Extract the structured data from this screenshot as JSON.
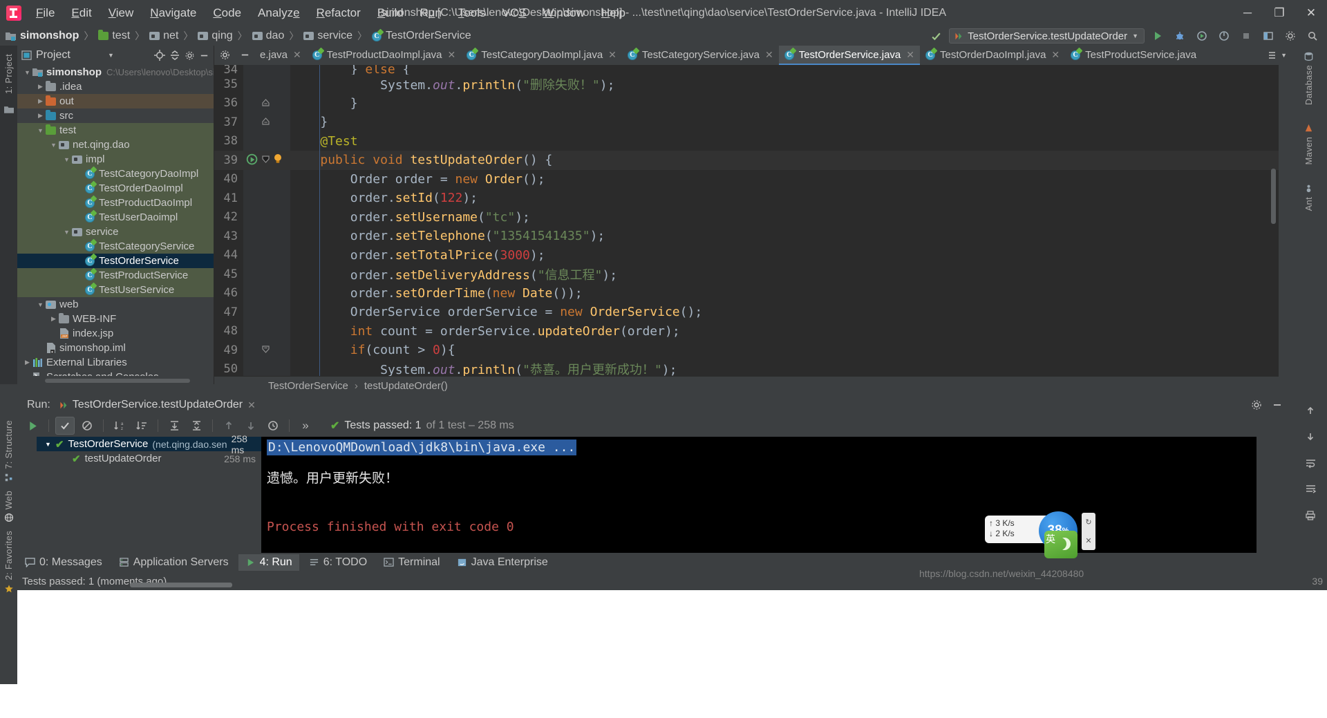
{
  "titlebar": {
    "app_icon": "intellij-logo-icon",
    "window_title": "simonshop [C:\\Users\\lenovo\\Desktop\\simonshop] - ...\\test\\net\\qing\\dao\\service\\TestOrderService.java - IntelliJ IDEA",
    "menus": [
      {
        "label": "File"
      },
      {
        "label": "Edit"
      },
      {
        "label": "View"
      },
      {
        "label": "Navigate"
      },
      {
        "label": "Code"
      },
      {
        "label": "Analyze"
      },
      {
        "label": "Refactor"
      },
      {
        "label": "Build"
      },
      {
        "label": "Run"
      },
      {
        "label": "Tools"
      },
      {
        "label": "VCS"
      },
      {
        "label": "Window"
      },
      {
        "label": "Help"
      }
    ],
    "minimize": "─",
    "maximize": "❐",
    "close": "✕"
  },
  "breadcrumb": {
    "items": [
      {
        "label": "simonshop",
        "icon": "module-folder-icon"
      },
      {
        "label": "test",
        "icon": "test-folder-icon"
      },
      {
        "label": "net",
        "icon": "package-icon"
      },
      {
        "label": "qing",
        "icon": "package-icon"
      },
      {
        "label": "dao",
        "icon": "package-icon"
      },
      {
        "label": "service",
        "icon": "package-icon"
      },
      {
        "label": "TestOrderService",
        "icon": "java-class-icon"
      }
    ],
    "separator": "〉"
  },
  "run_config": {
    "name": "TestOrderService.testUpdateOrder",
    "dropdown_icon": "chevron-down-icon",
    "buttons": [
      "run-icon",
      "debug-icon",
      "run-with-coverage-icon",
      "profile-icon",
      "stop-icon",
      "layout-icon",
      "settings-icon",
      "search-icon"
    ]
  },
  "project_panel": {
    "title": "Project",
    "dropdown_icon": "chevron-down-icon",
    "target_icon": "scroll-from-source-icon",
    "collapse_icon": "collapse-all-icon",
    "settings_icon": "gear-icon",
    "hide_icon": "hide-icon",
    "strip_label": "1: Project",
    "tree": [
      {
        "label": "simonshop",
        "path": "C:\\Users\\lenovo\\Desktop\\sim",
        "depth": 0,
        "arrow": "▼",
        "icon": "module-icon",
        "bold": true,
        "scope": ""
      },
      {
        "label": ".idea",
        "path": "",
        "depth": 1,
        "arrow": "▶",
        "icon": "folder-gray-icon",
        "bold": false,
        "scope": ""
      },
      {
        "label": "out",
        "path": "",
        "depth": 1,
        "arrow": "▶",
        "icon": "folder-orange-icon",
        "bold": false,
        "scope": "out"
      },
      {
        "label": "src",
        "path": "",
        "depth": 1,
        "arrow": "▶",
        "icon": "folder-blue-icon",
        "bold": false,
        "scope": ""
      },
      {
        "label": "test",
        "path": "",
        "depth": 1,
        "arrow": "▼",
        "icon": "folder-green-icon",
        "bold": false,
        "scope": "test"
      },
      {
        "label": "net.qing.dao",
        "path": "",
        "depth": 2,
        "arrow": "▼",
        "icon": "package-icon",
        "bold": false,
        "scope": "test"
      },
      {
        "label": "impl",
        "path": "",
        "depth": 3,
        "arrow": "▼",
        "icon": "package-icon",
        "bold": false,
        "scope": "test"
      },
      {
        "label": "TestCategoryDaoImpl",
        "path": "",
        "depth": 4,
        "arrow": "",
        "icon": "java-test-class-icon",
        "bold": false,
        "scope": "test"
      },
      {
        "label": "TestOrderDaoImpl",
        "path": "",
        "depth": 4,
        "arrow": "",
        "icon": "java-test-class-icon",
        "bold": false,
        "scope": "test"
      },
      {
        "label": "TestProductDaoImpl",
        "path": "",
        "depth": 4,
        "arrow": "",
        "icon": "java-test-class-icon",
        "bold": false,
        "scope": "test"
      },
      {
        "label": "TestUserDaoimpl",
        "path": "",
        "depth": 4,
        "arrow": "",
        "icon": "java-test-class-icon",
        "bold": false,
        "scope": "test"
      },
      {
        "label": "service",
        "path": "",
        "depth": 3,
        "arrow": "▼",
        "icon": "package-icon",
        "bold": false,
        "scope": "test"
      },
      {
        "label": "TestCategoryService",
        "path": "",
        "depth": 4,
        "arrow": "",
        "icon": "java-test-class-icon",
        "bold": false,
        "scope": "test"
      },
      {
        "label": "TestOrderService",
        "path": "",
        "depth": 4,
        "arrow": "",
        "icon": "java-test-class-icon",
        "bold": false,
        "scope": "selected"
      },
      {
        "label": "TestProductService",
        "path": "",
        "depth": 4,
        "arrow": "",
        "icon": "java-test-class-icon",
        "bold": false,
        "scope": "test"
      },
      {
        "label": "TestUserService",
        "path": "",
        "depth": 4,
        "arrow": "",
        "icon": "java-test-class-icon",
        "bold": false,
        "scope": "test"
      },
      {
        "label": "web",
        "path": "",
        "depth": 1,
        "arrow": "▼",
        "icon": "web-folder-icon",
        "bold": false,
        "scope": ""
      },
      {
        "label": "WEB-INF",
        "path": "",
        "depth": 2,
        "arrow": "▶",
        "icon": "folder-gray-icon",
        "bold": false,
        "scope": ""
      },
      {
        "label": "index.jsp",
        "path": "",
        "depth": 2,
        "arrow": "",
        "icon": "jsp-file-icon",
        "bold": false,
        "scope": ""
      },
      {
        "label": "simonshop.iml",
        "path": "",
        "depth": 1,
        "arrow": "",
        "icon": "iml-file-icon",
        "bold": false,
        "scope": ""
      },
      {
        "label": "External Libraries",
        "path": "",
        "depth": 0,
        "arrow": "▶",
        "icon": "libraries-icon",
        "bold": false,
        "scope": ""
      },
      {
        "label": "Scratches and Consoles",
        "path": "",
        "depth": 0,
        "arrow": "",
        "icon": "scratches-icon",
        "bold": false,
        "scope": ""
      }
    ]
  },
  "editor_tabs": [
    {
      "label": "e.java",
      "icon": "java-class-icon",
      "active": false,
      "close": "✕"
    },
    {
      "label": "TestProductDaoImpl.java",
      "icon": "java-class-icon",
      "active": false,
      "close": "✕"
    },
    {
      "label": "TestCategoryDaoImpl.java",
      "icon": "java-class-icon",
      "active": false,
      "close": "✕"
    },
    {
      "label": "TestCategoryService.java",
      "icon": "java-class-icon",
      "active": false,
      "close": "✕"
    },
    {
      "label": "TestOrderService.java",
      "icon": "java-class-icon",
      "active": true,
      "close": "✕"
    },
    {
      "label": "TestOrderDaoImpl.java",
      "icon": "java-class-icon",
      "active": false,
      "close": "✕"
    },
    {
      "label": "TestProductService.java",
      "icon": "java-class-icon",
      "active": false,
      "close": ""
    }
  ],
  "editor": {
    "first_partial_line": "34",
    "lines": [
      {
        "no": "35",
        "text": "            System.out.println(\"删除失败！\");",
        "highlight": false
      },
      {
        "no": "36",
        "text": "        }",
        "highlight": false
      },
      {
        "no": "37",
        "text": "    }",
        "highlight": false
      },
      {
        "no": "38",
        "text": "    @Test",
        "highlight": false
      },
      {
        "no": "39",
        "text": "    public void testUpdateOrder() {",
        "highlight": true
      },
      {
        "no": "40",
        "text": "        Order order = new Order();",
        "highlight": false
      },
      {
        "no": "41",
        "text": "        order.setId(122);",
        "highlight": false
      },
      {
        "no": "42",
        "text": "        order.setUsername(\"tc\");",
        "highlight": false
      },
      {
        "no": "43",
        "text": "        order.setTelephone(\"13541541435\");",
        "highlight": false
      },
      {
        "no": "44",
        "text": "        order.setTotalPrice(3000);",
        "highlight": false
      },
      {
        "no": "45",
        "text": "        order.setDeliveryAddress(\"信息工程\");",
        "highlight": false
      },
      {
        "no": "46",
        "text": "        order.setOrderTime(new Date());",
        "highlight": false
      },
      {
        "no": "47",
        "text": "        OrderService orderService = new OrderService();",
        "highlight": false
      },
      {
        "no": "48",
        "text": "        int count = orderService.updateOrder(order);",
        "highlight": false
      },
      {
        "no": "49",
        "text": "        if(count > 0){",
        "highlight": false
      },
      {
        "no": "50",
        "text": "            System.out.println(\"恭喜。用户更新成功！\");",
        "highlight": false
      }
    ],
    "bottom_breadcrumb": [
      {
        "label": "TestOrderService"
      },
      {
        "label": "testUpdateOrder()"
      }
    ],
    "bottom_breadcrumb_sep": "›",
    "gutter_icons": {
      "run_test": "run-test-gutter-icon",
      "bulb": "intention-bulb-icon",
      "fold": "fold-arrow-icon"
    }
  },
  "right_strips": [
    {
      "label": "Database",
      "icon": "database-icon"
    },
    {
      "label": "Maven",
      "icon": "maven-icon"
    },
    {
      "label": "Ant",
      "icon": "ant-icon"
    }
  ],
  "left_strips_bottom": [
    {
      "label": "7: Structure",
      "icon": "structure-icon"
    },
    {
      "label": "Web",
      "icon": "web-icon"
    },
    {
      "label": "2: Favorites",
      "icon": "favorites-icon"
    }
  ],
  "run_panel": {
    "label": "Run:",
    "config_icon": "run-config-icon",
    "config_name": "TestOrderService.testUpdateOrder",
    "close": "✕",
    "settings_icon": "gear-icon",
    "hide_icon": "hide-icon",
    "toolbar": [
      {
        "name": "rerun-icon",
        "glyph": "▶",
        "state": "play"
      },
      {
        "name": "show-passed-icon",
        "glyph": "✓",
        "state": "on"
      },
      {
        "name": "hide-ignored-icon",
        "glyph": "⊘",
        "state": "off"
      },
      {
        "name": "sort-alphabetically-icon",
        "glyph": "↓",
        "state": "off"
      },
      {
        "name": "sort-by-duration-icon",
        "glyph": "↓",
        "state": "off"
      },
      {
        "name": "expand-all-icon",
        "glyph": "↧",
        "state": "off"
      },
      {
        "name": "collapse-all-icon",
        "glyph": "↥",
        "state": "off"
      },
      {
        "name": "prev-failed-icon",
        "glyph": "↑",
        "state": "dim"
      },
      {
        "name": "next-failed-icon",
        "glyph": "↓",
        "state": "dim"
      },
      {
        "name": "test-history-icon",
        "glyph": "◴",
        "state": "off"
      },
      {
        "name": "more-icon",
        "glyph": "»",
        "state": "off"
      }
    ],
    "status_check": "✔",
    "status_text": "Tests passed: 1",
    "status_dim": "of 1 test – 258 ms",
    "test_tree": [
      {
        "label": "TestOrderService",
        "sub": "(net.qing.dao.sen",
        "duration": "258 ms",
        "selected": true,
        "arrow": "▼",
        "status": "✔",
        "depth": 0
      },
      {
        "label": "testUpdateOrder",
        "sub": "",
        "duration": "258 ms",
        "selected": false,
        "arrow": "",
        "status": "✔",
        "depth": 1
      }
    ],
    "console": {
      "command_line": "D:\\LenovoQMDownload\\jdk8\\bin\\java.exe ...",
      "output_line": "遗憾。用户更新失败！",
      "exit_line": "Process finished with exit code 0"
    },
    "console_side_icons": [
      "scroll-up-icon",
      "scroll-down-icon",
      "soft-wrap-icon",
      "scroll-to-end-icon",
      "print-icon"
    ],
    "left_icons": [
      "run-icon",
      "rerun-icon",
      "stop-icon",
      "pin-icon",
      "close-icon"
    ]
  },
  "toolwindow_bar": [
    {
      "label": "0: Messages",
      "icon": "messages-icon",
      "active": false
    },
    {
      "label": "Application Servers",
      "icon": "server-icon",
      "active": false
    },
    {
      "label": "4: Run",
      "icon": "run-icon",
      "active": true
    },
    {
      "label": "6: TODO",
      "icon": "todo-icon",
      "active": false
    },
    {
      "label": "Terminal",
      "icon": "terminal-icon",
      "active": false
    },
    {
      "label": "Java Enterprise",
      "icon": "java-enterprise-icon",
      "active": false
    }
  ],
  "statusbar": {
    "icon": "event-log-icon",
    "text": "Tests passed: 1 (moments ago)",
    "right_text": "39"
  },
  "floating_widget": {
    "speed_up": "↑ 3  K/s",
    "speed_down": "↓ 2  K/s",
    "percent": "38",
    "percent_symbol": "%",
    "ime_label": "英"
  },
  "watermark": "https://blog.csdn.net/weixin_44208480",
  "colors": {
    "accent_blue": "#4a88c7",
    "selection": "#0d293e",
    "test_scope": "#4f5a44",
    "out_scope": "#554a3c",
    "console_bg": "#000000",
    "editor_bg": "#2b2b2b",
    "chrome_bg": "#3c3f41",
    "green": "#59a869",
    "red": "#cf3f3f"
  }
}
